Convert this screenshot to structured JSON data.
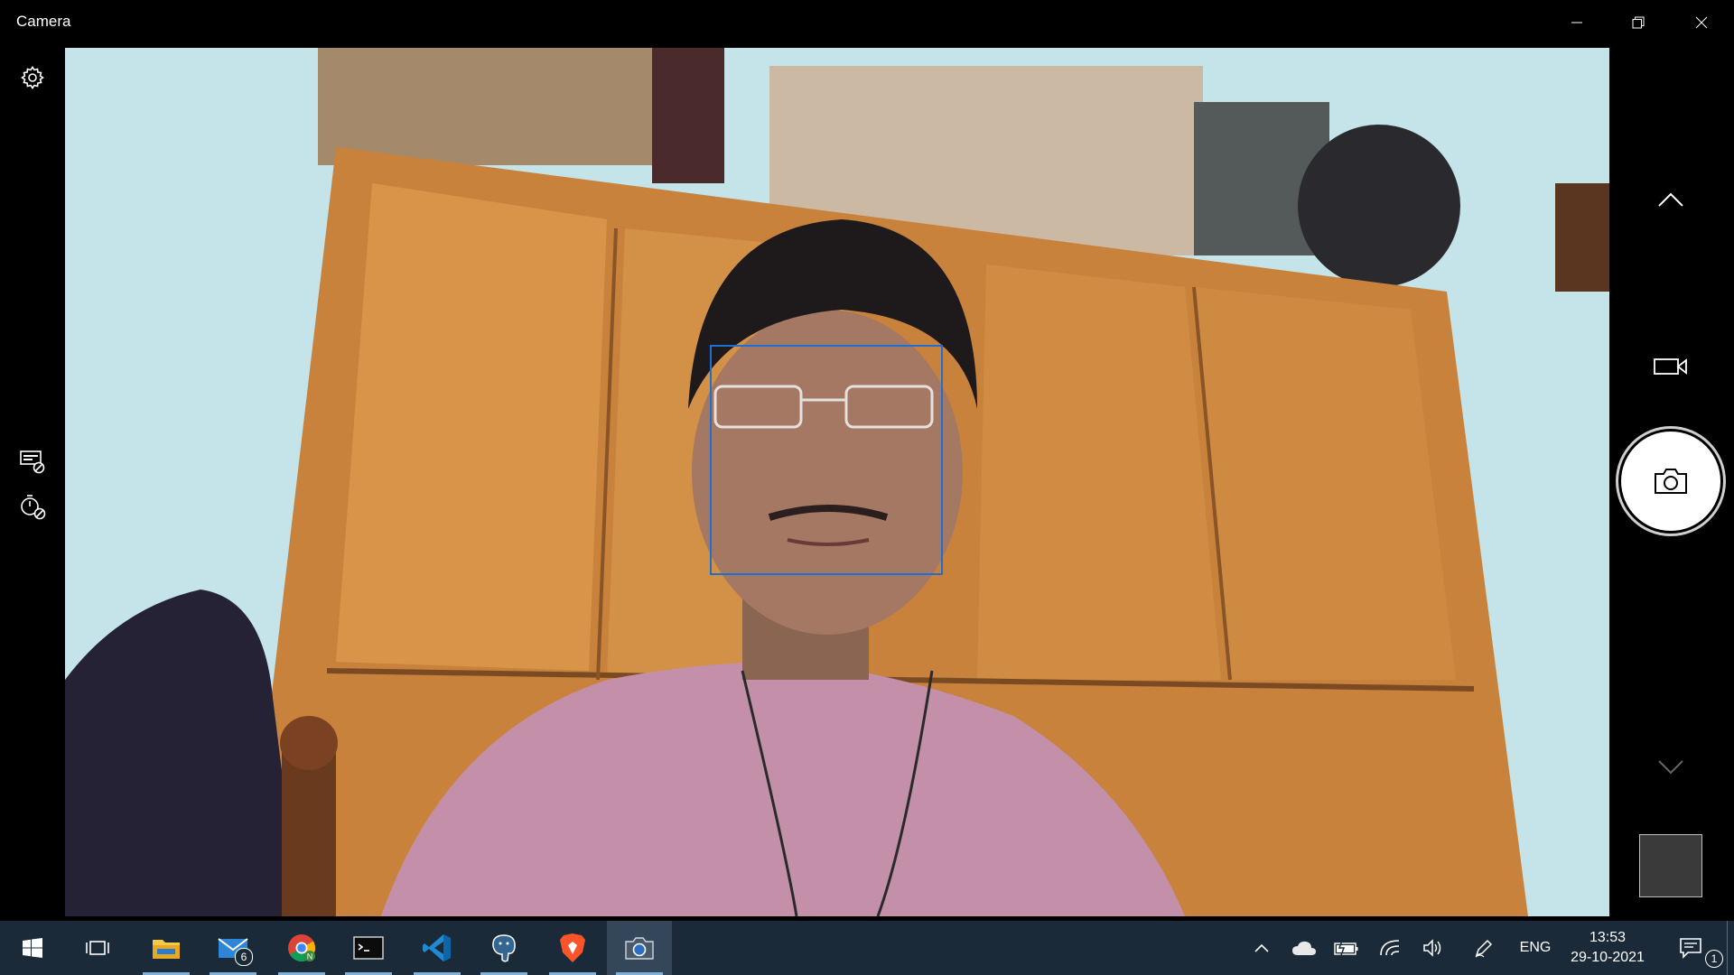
{
  "window": {
    "title": "Camera"
  },
  "left_rail": {
    "settings_icon": "gear-icon",
    "hdr_icon": "hdr-off-icon",
    "timer_icon": "timer-off-icon"
  },
  "right_rail": {
    "scroll_up_icon": "chevron-up-icon",
    "video_mode_icon": "video-camera-icon",
    "photo_button_icon": "camera-icon",
    "scroll_down_icon": "chevron-down-icon"
  },
  "taskbar": {
    "apps": [
      {
        "name": "start-icon"
      },
      {
        "name": "task-view-icon"
      },
      {
        "name": "file-explorer-icon"
      },
      {
        "name": "mail-icon",
        "badge": "6"
      },
      {
        "name": "chrome-icon"
      },
      {
        "name": "terminal-icon"
      },
      {
        "name": "vscode-icon"
      },
      {
        "name": "postgres-icon"
      },
      {
        "name": "brave-icon"
      },
      {
        "name": "camera-app-icon"
      }
    ],
    "tray": {
      "language": "ENG",
      "time": "13:53",
      "date": "29-10-2021",
      "notifications_count": "1"
    }
  },
  "colors": {
    "face_box": "#1e6fd0",
    "taskbar": "#1b2a38"
  }
}
